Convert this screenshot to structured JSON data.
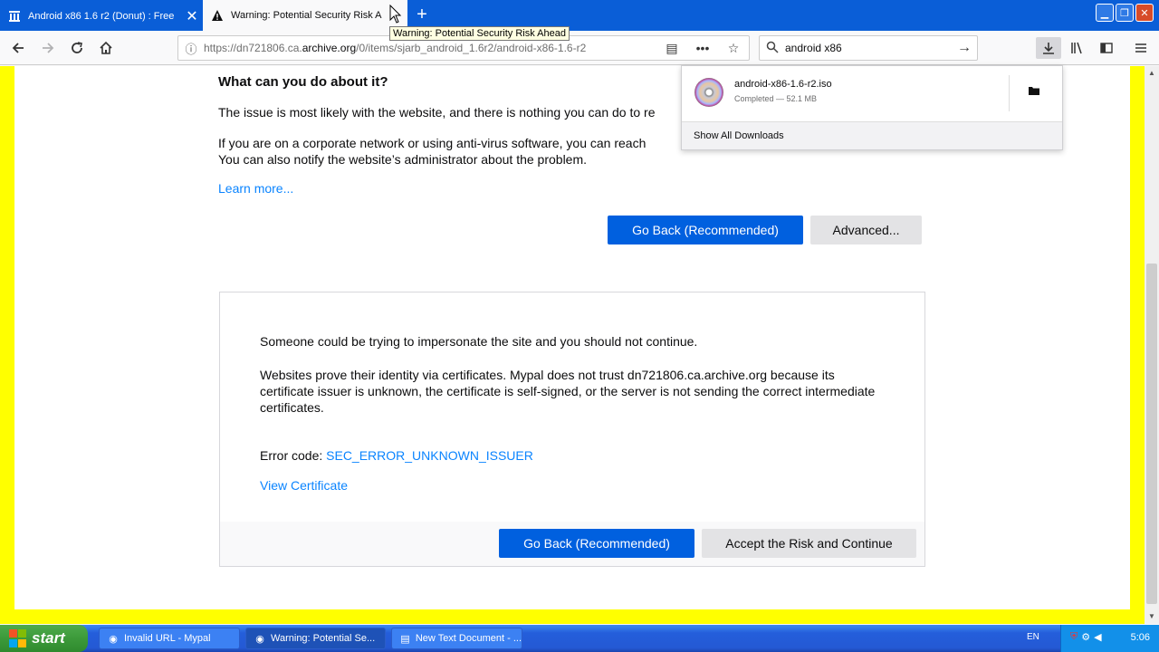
{
  "tabs": [
    {
      "label": "Android x86 1.6 r2 (Donut) : Free",
      "icon": "archive-icon"
    },
    {
      "label": "Warning: Potential Security Risk A",
      "icon": "warning-icon",
      "active": true
    }
  ],
  "tooltip": "Warning: Potential Security Risk Ahead",
  "url": {
    "prefix": "https://dn721806.ca.",
    "host": "archive.org",
    "suffix": "/0/items/sjarb_android_1.6r2/android-x86-1.6-r2"
  },
  "search": {
    "value": "android x86"
  },
  "page": {
    "heading": "What can you do about it?",
    "p1": "The issue is most likely with the website, and there is nothing you can do to re",
    "p2_line1": "If you are on a corporate network or using anti-virus software, you can reach",
    "p2_line2": "You can also notify the website’s administrator about the problem.",
    "learn_more": "Learn more...",
    "go_back": "Go Back (Recommended)",
    "advanced": "Advanced...",
    "adv_text1": "Someone could be trying to impersonate the site and you should not continue.",
    "adv_text2": "Websites prove their identity via certificates. Mypal does not trust dn721806.ca.archive.org because its certificate issuer is unknown, the certificate is self-signed, or the server is not sending the correct intermediate certificates.",
    "error_label": "Error code: ",
    "error_code": "SEC_ERROR_UNKNOWN_ISSUER",
    "view_certificate": "View Certificate",
    "go_back2": "Go Back (Recommended)",
    "accept": "Accept the Risk and Continue"
  },
  "downloads": {
    "file": "android-x86-1.6-r2.iso",
    "status": "Completed — 52.1 MB",
    "show_all": "Show All Downloads"
  },
  "taskbar": {
    "start": "start",
    "tasks": [
      {
        "label": "Invalid URL - Mypal"
      },
      {
        "label": "Warning: Potential Se..."
      },
      {
        "label": "New Text Document - ..."
      }
    ],
    "lang": "EN",
    "clock": "5:06"
  },
  "colors": {
    "accent": "#0060df",
    "link": "#0a84ff",
    "page_border": "#ffff00",
    "titlebar": "#0a5ed7"
  }
}
